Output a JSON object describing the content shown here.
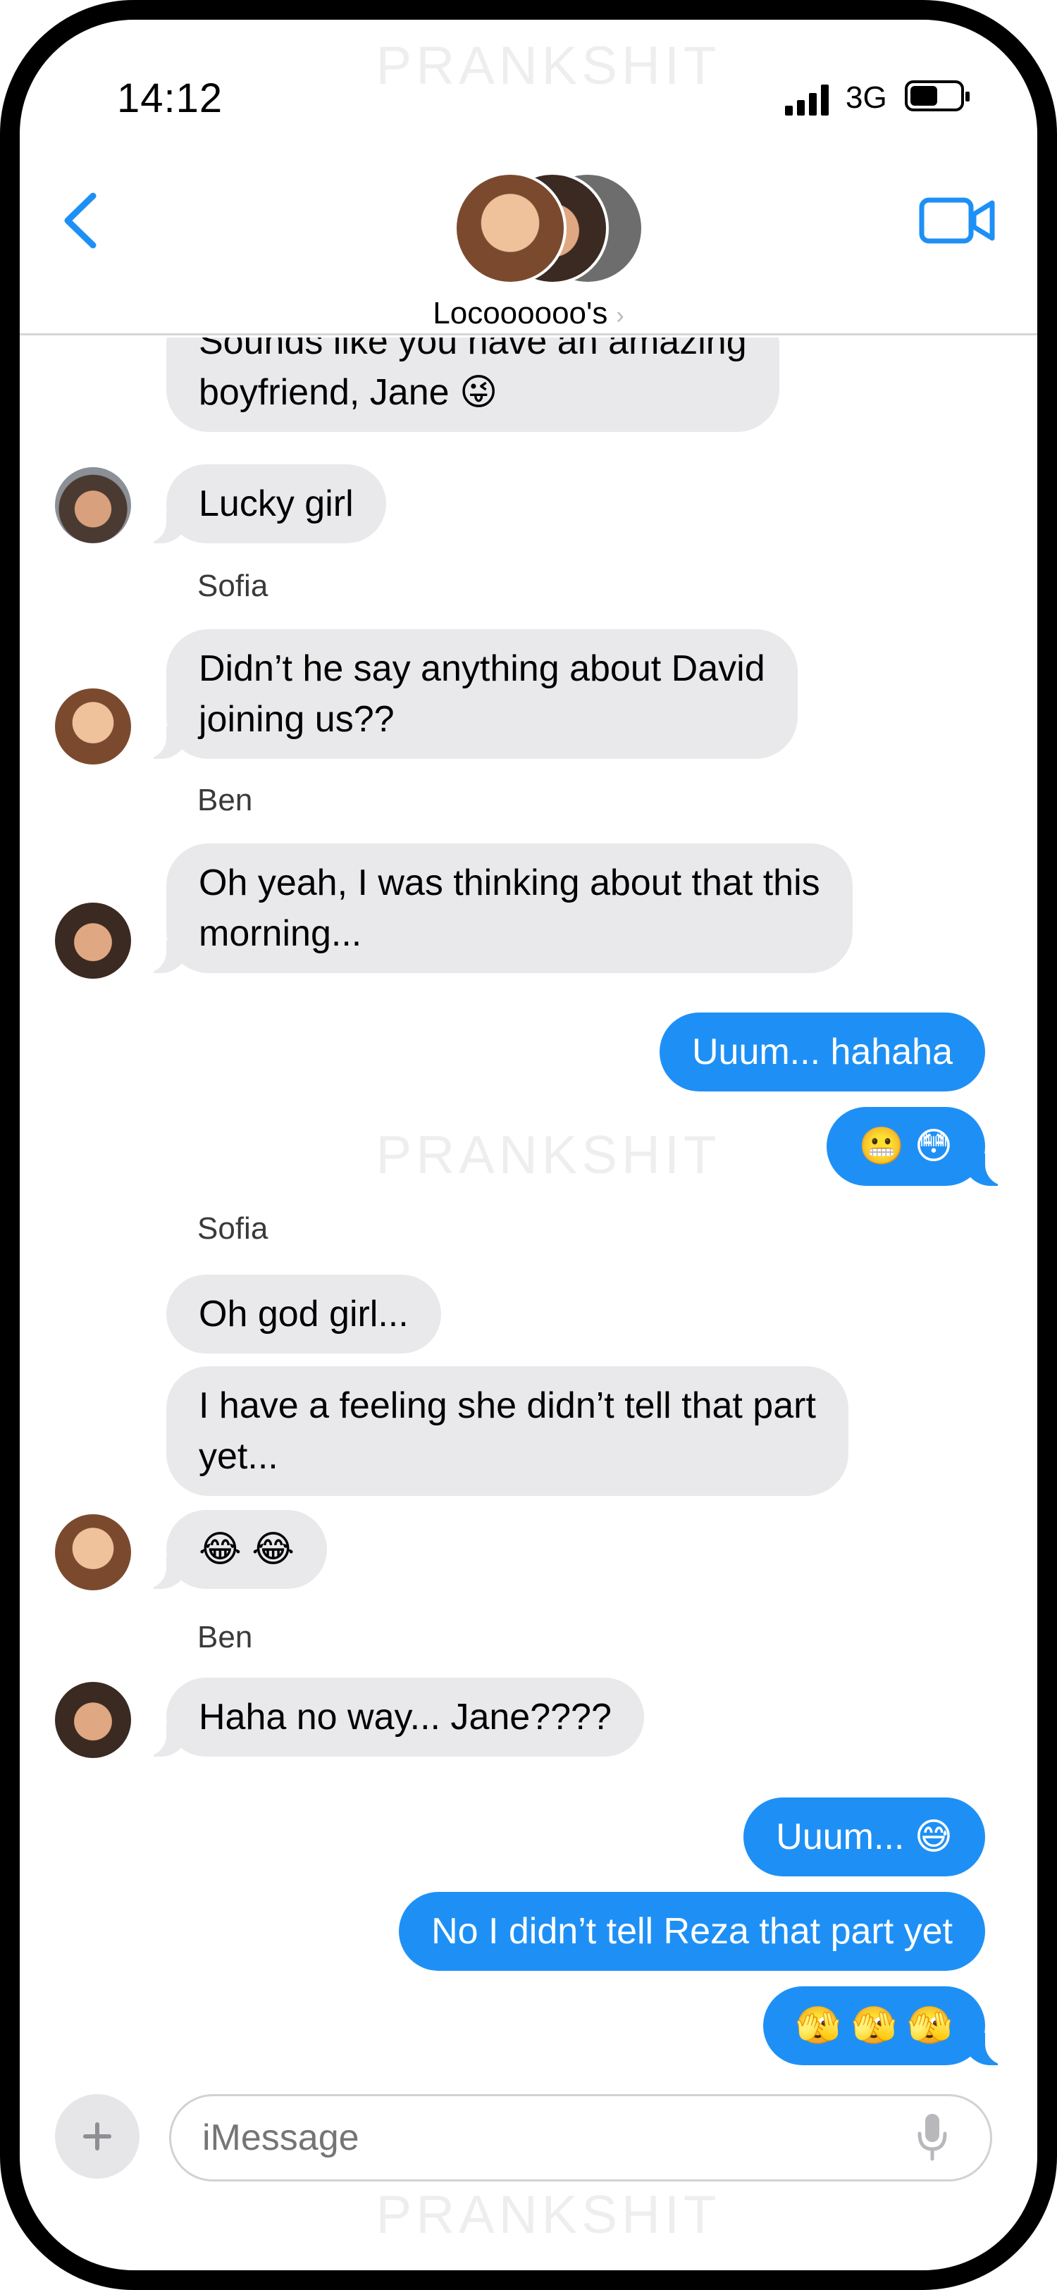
{
  "watermark": "PRANKSHIT",
  "status": {
    "time": "14:12",
    "network": "3G"
  },
  "header": {
    "group_name": "Locoooooo's",
    "chevron": "›"
  },
  "messages": [
    {
      "type": "in",
      "text": "Sounds like you have an amazing\nboyfriend, Jane 😜"
    },
    {
      "type": "in",
      "text": "Lucky girl"
    },
    {
      "type": "sender",
      "text": "Sofia"
    },
    {
      "type": "in",
      "text": "Didn’t he say anything about David\njoining us??"
    },
    {
      "type": "sender",
      "text": "Ben"
    },
    {
      "type": "in",
      "text": "Oh yeah, I was thinking about that this\nmorning..."
    },
    {
      "type": "out",
      "text": "Uuum... hahaha"
    },
    {
      "type": "out",
      "text": "😬 😳"
    },
    {
      "type": "sender",
      "text": "Sofia"
    },
    {
      "type": "in",
      "text": "Oh god girl..."
    },
    {
      "type": "in",
      "text": "I have a feeling she didn’t tell that part\nyet..."
    },
    {
      "type": "in",
      "text": "😂 😂"
    },
    {
      "type": "sender",
      "text": "Ben"
    },
    {
      "type": "in",
      "text": "Haha no way... Jane????"
    },
    {
      "type": "out",
      "text": "Uuum... 😅"
    },
    {
      "type": "out",
      "text": "No I didn’t tell Reza that part yet"
    },
    {
      "type": "out",
      "text": "🫣 🫣 🫣"
    }
  ],
  "composer": {
    "placeholder": "iMessage"
  },
  "icons": {
    "back": "chevron-left-icon",
    "video": "video-camera-icon",
    "plus": "plus-icon",
    "mic": "microphone-icon"
  },
  "colors": {
    "accent": "#1e90f5",
    "incoming_bubble": "#e9e9eb"
  }
}
